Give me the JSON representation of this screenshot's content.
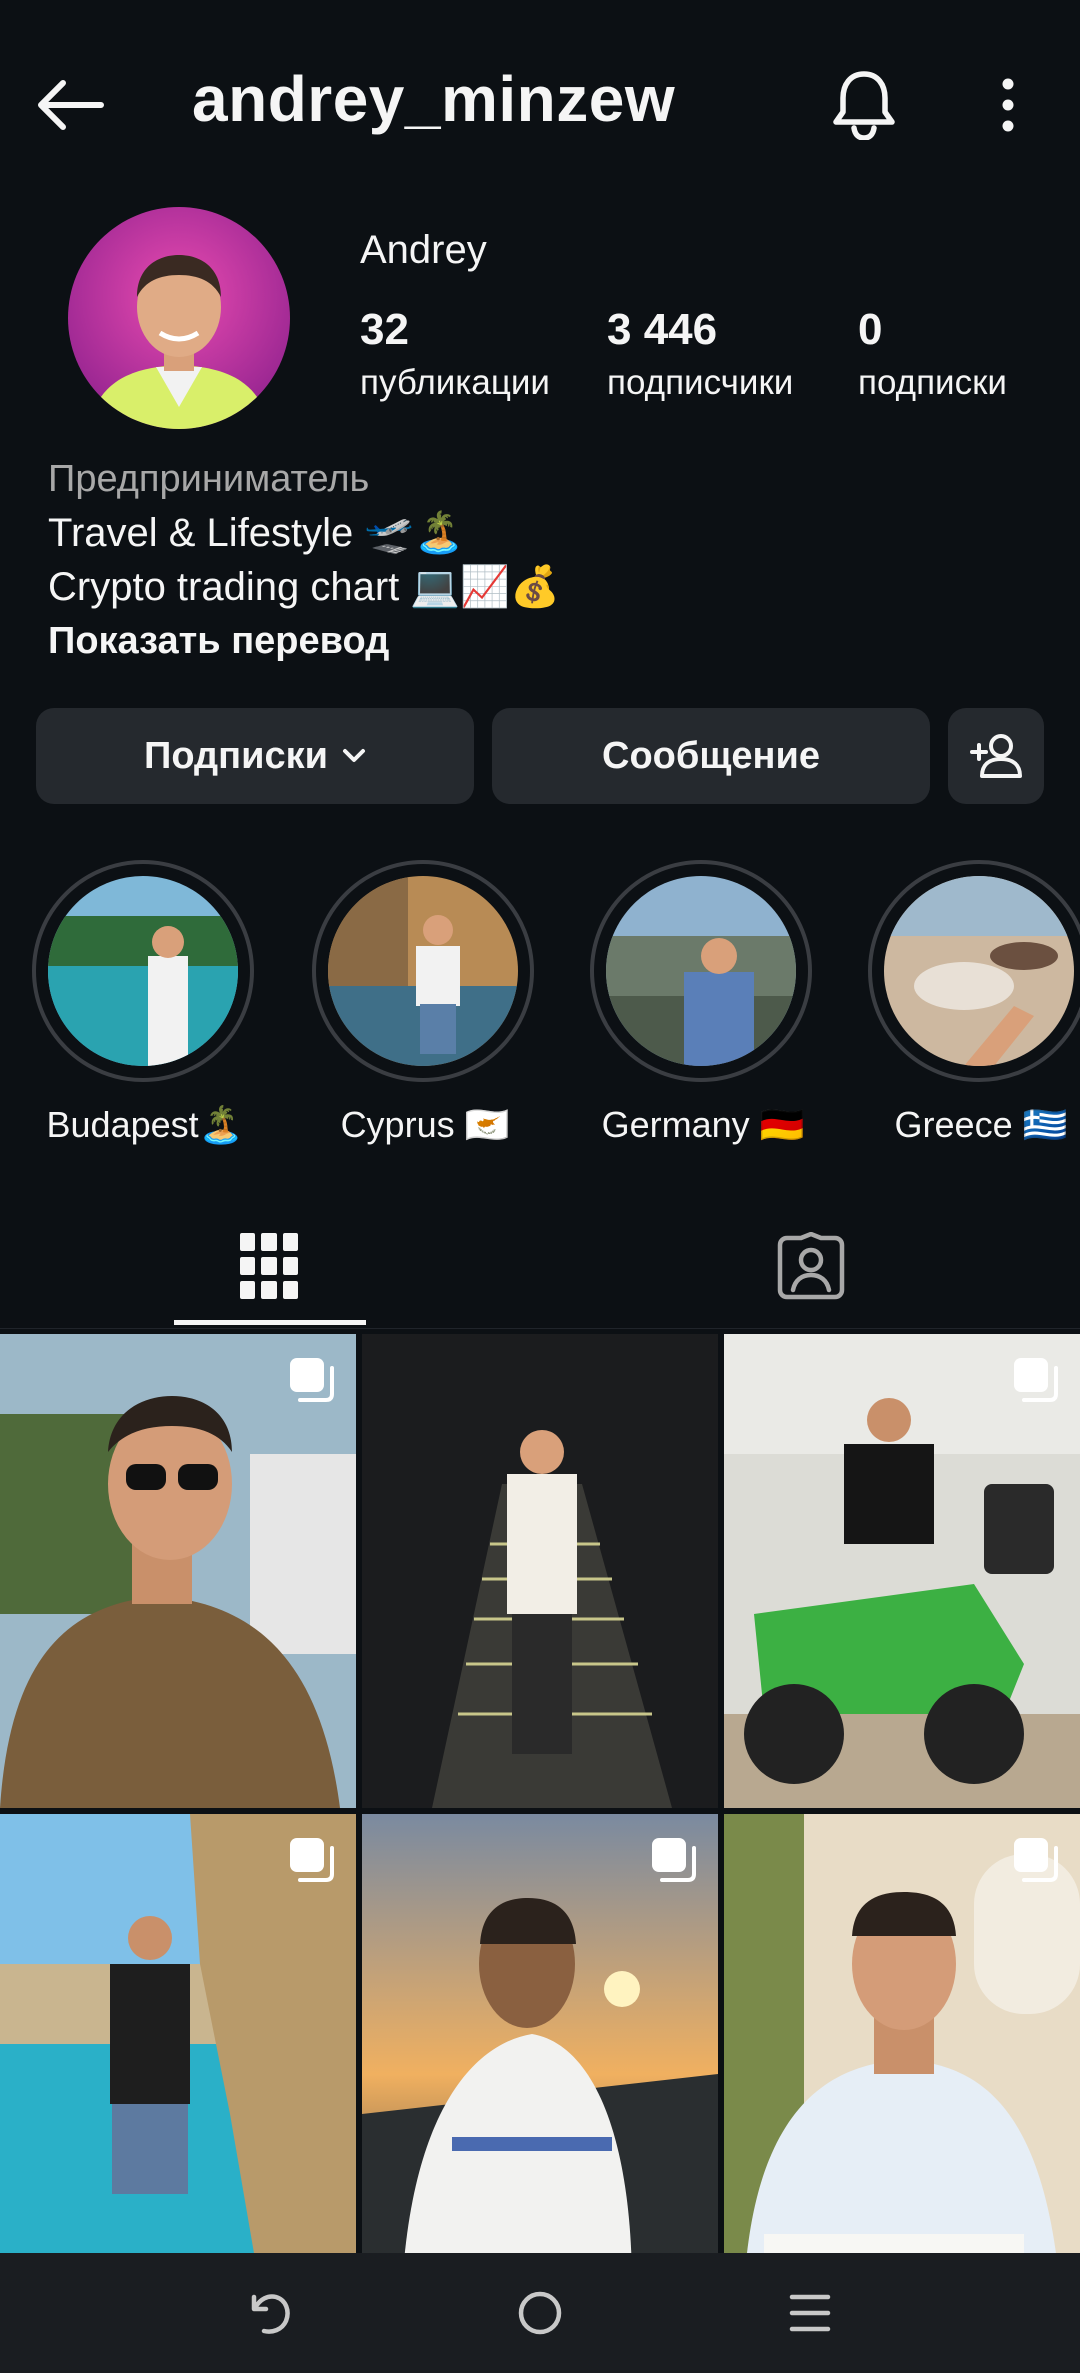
{
  "header": {
    "username": "andrey_minzew"
  },
  "profile": {
    "display_name": "Andrey",
    "stats": [
      {
        "value": "32",
        "label": "публикации"
      },
      {
        "value": "3 446",
        "label": "подписчики"
      },
      {
        "value": "0",
        "label": "подписки"
      }
    ]
  },
  "bio": {
    "category": "Предприниматель",
    "line1": "Travel & Lifestyle 🛫🏝️",
    "line2": "Crypto trading chart 💻📈💰",
    "translate": "Показать перевод"
  },
  "actions": {
    "following_label": "Подписки",
    "message_label": "Сообщение"
  },
  "highlights": [
    {
      "label": "Budapest🏝️"
    },
    {
      "label": "Cyprus 🇨🇾"
    },
    {
      "label": "Germany 🇩🇪"
    },
    {
      "label": "Greece 🇬🇷"
    }
  ],
  "tabs": {
    "active": "posts-grid"
  },
  "colors": {
    "background": "#0c1014",
    "button": "#25292e",
    "text": "#f5f5f5",
    "muted": "#a8a8a8"
  },
  "icons": [
    "arrow-left-icon",
    "bell-icon",
    "more-vertical-icon",
    "chevron-down-icon",
    "add-user-icon",
    "grid-icon",
    "tagged-user-icon",
    "multiple-posts-icon",
    "nav-back-icon",
    "nav-home-icon",
    "nav-recents-icon"
  ]
}
